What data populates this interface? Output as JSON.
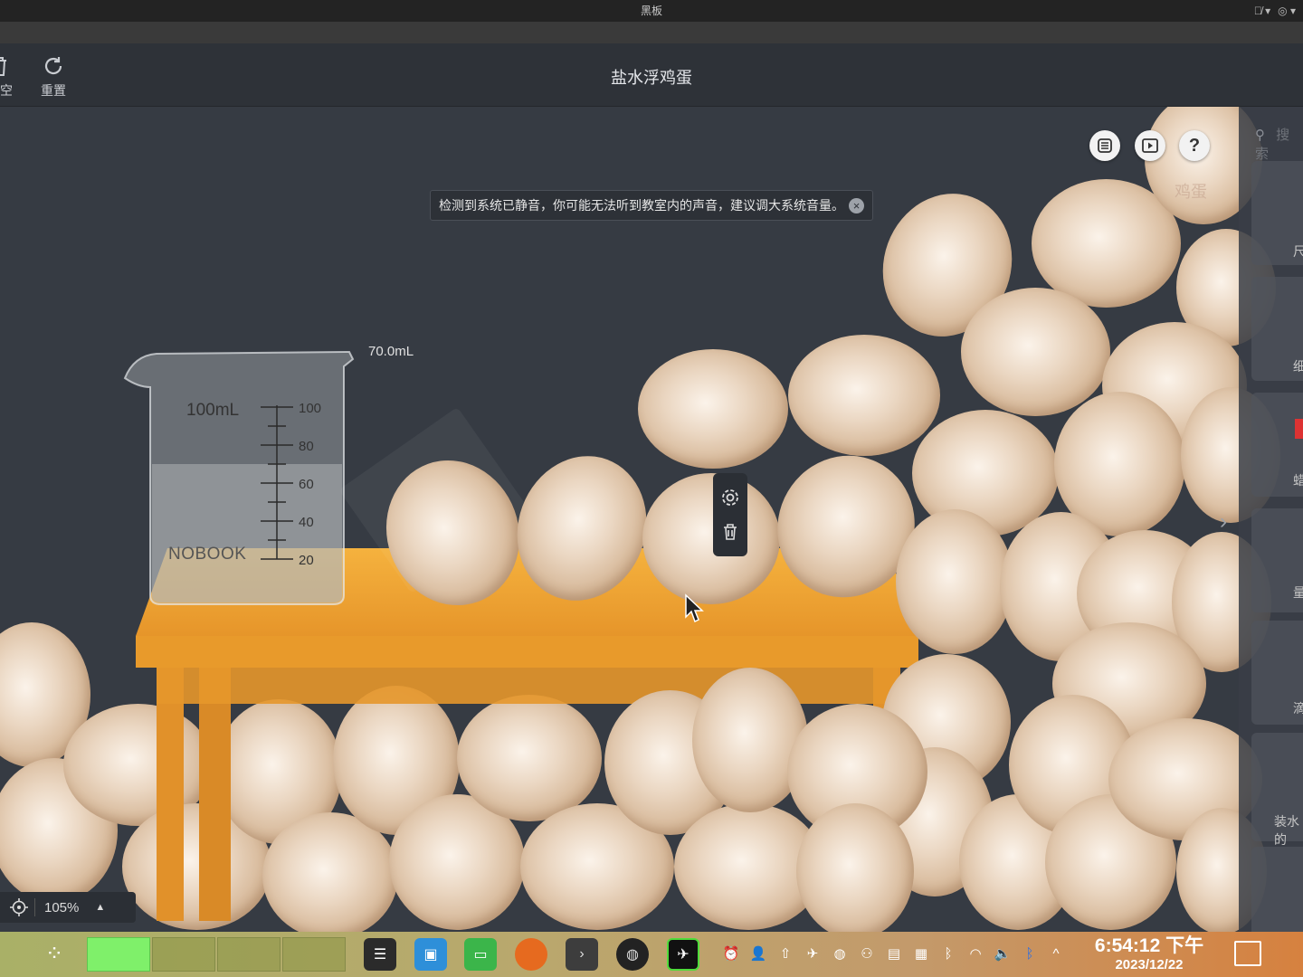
{
  "os": {
    "window_title": "黑板"
  },
  "toolbar": {
    "clear_label": "清空",
    "reset_label": "重置",
    "title": "盐水浮鸡蛋"
  },
  "canvas": {
    "egg_label": "鸡蛋",
    "notice": "检测到系统已静音，你可能无法听到教室内的声音，建议调大系统音量。",
    "volume_label": "70.0mL",
    "beaker": {
      "capacity_label": "100mL",
      "brand": "NOBOOK",
      "ticks": [
        "100",
        "80",
        "60",
        "40",
        "20"
      ]
    },
    "zoom": "105%"
  },
  "side_panel": {
    "search_placeholder": "搜索",
    "labels": [
      "尺",
      "细",
      "蜡",
      "量",
      "滴",
      "装水的"
    ]
  },
  "taskbar": {
    "time": "6:54:12 下午",
    "date": "2023/12/22"
  },
  "colors": {
    "canvas_bg": "#363b43",
    "table": "#f0a42e",
    "egg": "#ead6c1",
    "workspace_active": "#7ff06a"
  }
}
